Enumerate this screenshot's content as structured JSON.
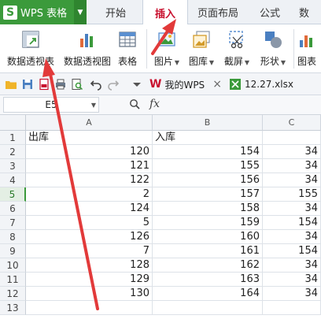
{
  "app": {
    "name": "WPS 表格",
    "logo_letter": "S"
  },
  "tabs": [
    {
      "label": "开始"
    },
    {
      "label": "插入"
    },
    {
      "label": "页面布局"
    },
    {
      "label": "公式"
    },
    {
      "label": "数"
    }
  ],
  "ribbon": {
    "pivot_table": "数据透视表",
    "pivot_chart": "数据透视图",
    "table": "表格",
    "picture": "图片",
    "gallery": "图库",
    "screenshot": "截屏",
    "shape": "形状",
    "chart": "图表"
  },
  "quickbar": {
    "doc_tab_1": "我的WPS",
    "doc_tab_2": "12.27.xlsx",
    "close_glyph": "×"
  },
  "formula_bar": {
    "cell_ref": "E5",
    "fx": "fx"
  },
  "sheet": {
    "columns": [
      "A",
      "B",
      "C"
    ],
    "rows": [
      {
        "n": "1",
        "a": "出库",
        "b": "入库",
        "c": ""
      },
      {
        "n": "2",
        "a": "120",
        "b": "154",
        "c": "34"
      },
      {
        "n": "3",
        "a": "121",
        "b": "155",
        "c": "34"
      },
      {
        "n": "4",
        "a": "122",
        "b": "156",
        "c": "34"
      },
      {
        "n": "5",
        "a": "2",
        "b": "157",
        "c": "155"
      },
      {
        "n": "6",
        "a": "124",
        "b": "158",
        "c": "34"
      },
      {
        "n": "7",
        "a": "5",
        "b": "159",
        "c": "154"
      },
      {
        "n": "8",
        "a": "126",
        "b": "160",
        "c": "34"
      },
      {
        "n": "9",
        "a": "7",
        "b": "161",
        "c": "154"
      },
      {
        "n": "10",
        "a": "128",
        "b": "162",
        "c": "34"
      },
      {
        "n": "11",
        "a": "129",
        "b": "163",
        "c": "34"
      },
      {
        "n": "12",
        "a": "130",
        "b": "164",
        "c": "34"
      },
      {
        "n": "13",
        "a": "",
        "b": "",
        "c": ""
      }
    ],
    "selected_row": "5"
  },
  "colors": {
    "accent_green": "#3b9a3b",
    "active_tab_red": "#c8102e",
    "arrow_red": "#e23a3a"
  }
}
